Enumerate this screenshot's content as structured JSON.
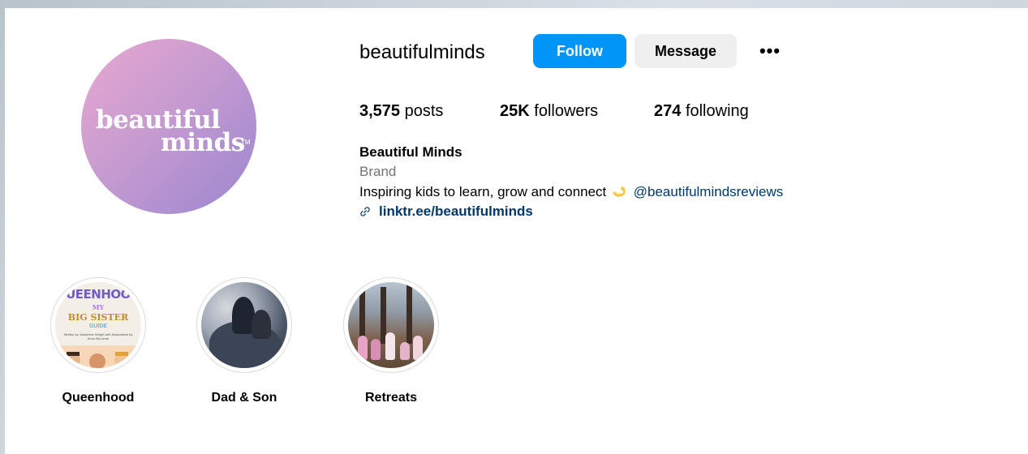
{
  "profile": {
    "username": "beautifulminds",
    "avatar_text_line1": "beautiful",
    "avatar_text_line2": "minds",
    "avatar_tm": "TM",
    "buttons": {
      "follow": "Follow",
      "message": "Message",
      "more": "•••"
    },
    "stats": {
      "posts_count": "3,575",
      "posts_label": "posts",
      "followers_count": "25K",
      "followers_label": "followers",
      "following_count": "274",
      "following_label": "following"
    },
    "bio": {
      "name": "Beautiful Minds",
      "category": "Brand",
      "text": "Inspiring kids to learn, grow and connect",
      "mention": "@beautifulmindsreviews",
      "link": "linktr.ee/beautifulminds"
    }
  },
  "highlights": [
    {
      "label": "Queenhood",
      "cover_top": "UEENHOO",
      "cover_my": "MY",
      "cover_big": "BIG SISTER",
      "cover_guide": "GUIDE",
      "cover_small": "Written by Josephine Wright with Illustrations by Anon Bin Anne"
    },
    {
      "label": "Dad & Son"
    },
    {
      "label": "Retreats"
    }
  ],
  "colors": {
    "follow_bg": "#0095f6",
    "message_bg": "#efefef",
    "link": "#00376b",
    "muted": "#737373"
  }
}
